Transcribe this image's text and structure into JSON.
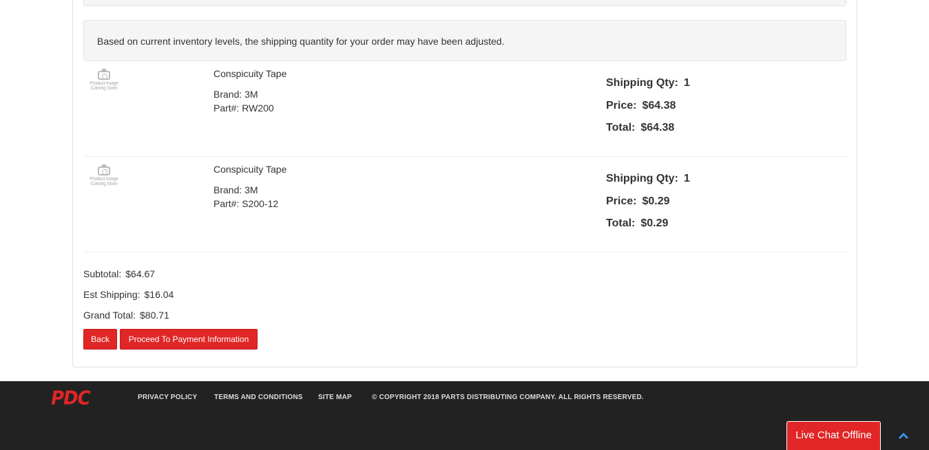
{
  "notice": "Based on current inventory levels, the shipping quantity for your order may have been adjusted.",
  "image_placeholder": {
    "line1": "Product Image",
    "line2": "Coming Soon"
  },
  "labels": {
    "shipping_qty": "Shipping Qty:",
    "price": "Price:",
    "total": "Total:"
  },
  "items": [
    {
      "name": "Conspicuity Tape",
      "brand": "Brand: 3M",
      "part": "Part#: RW200",
      "qty": "1",
      "price": "$64.38",
      "total": "$64.38"
    },
    {
      "name": "Conspicuity Tape",
      "brand": "Brand: 3M",
      "part": "Part#: S200-12",
      "qty": "1",
      "price": "$0.29",
      "total": "$0.29"
    }
  ],
  "summary": {
    "subtotal_label": "Subtotal:",
    "subtotal": "$64.67",
    "shipping_label": "Est Shipping:",
    "shipping": "$16.04",
    "grand_label": "Grand Total:",
    "grand": "$80.71"
  },
  "buttons": {
    "back": "Back",
    "proceed": "Proceed To Payment Information"
  },
  "footer": {
    "logo": "PDC",
    "links": [
      "PRIVACY POLICY",
      "TERMS AND CONDITIONS",
      "SITE MAP"
    ],
    "copyright": "© COPYRIGHT 2018 PARTS DISTRIBUTING COMPANY. ALL RIGHTS RESERVED."
  },
  "chat": "Live Chat Offline",
  "colors": {
    "accent": "#e02626",
    "footer_bg": "#222222",
    "scroll_icon": "#3a8ee6"
  },
  "icons": {
    "scroll_top": "chevron-up-icon",
    "placeholder": "camera-icon"
  }
}
